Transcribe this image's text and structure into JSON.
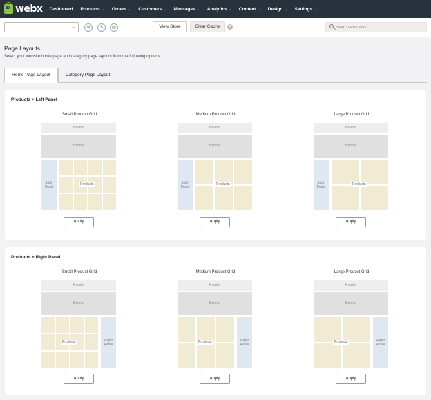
{
  "logo": {
    "mark": "BX",
    "text": "webx"
  },
  "nav": {
    "items": [
      {
        "label": "Dashboard",
        "has_menu": false
      },
      {
        "label": "Products",
        "has_menu": true
      },
      {
        "label": "Orders",
        "has_menu": true
      },
      {
        "label": "Customers",
        "has_menu": true
      },
      {
        "label": "Messages",
        "has_menu": true
      },
      {
        "label": "Analytics",
        "has_menu": true
      },
      {
        "label": "Content",
        "has_menu": true
      },
      {
        "label": "Design",
        "has_menu": true
      },
      {
        "label": "Settings",
        "has_menu": true
      }
    ]
  },
  "toolbar": {
    "store_select_value": "",
    "icons": [
      "cart-icon",
      "dollar-icon",
      "storefront-icon"
    ],
    "icon_glyphs": [
      "⊚",
      "$",
      "▤"
    ],
    "view_store_label": "View Store",
    "clear_cache_label": "Clear Cache",
    "help_glyph": "?",
    "search_placeholder": "Search Products..."
  },
  "page": {
    "title": "Page Layouts",
    "subtitle": "Select your website home page and category page layouts from the following options.",
    "tabs": [
      {
        "label": "Home Page Layout",
        "active": true
      },
      {
        "label": "Category Page Layout",
        "active": false
      }
    ]
  },
  "sections": [
    {
      "title": "Products + Left Panel",
      "panel_side": "left",
      "layouts": [
        {
          "title": "Small Product Grid",
          "header": "Header",
          "banner": "Banner",
          "panel": "Left Panel",
          "products": "Products",
          "apply": "Apply"
        },
        {
          "title": "Medium Product Grid",
          "header": "Header",
          "banner": "Banner",
          "panel": "Left Panel",
          "products": "Products",
          "apply": "Apply"
        },
        {
          "title": "Large Product Grid",
          "header": "Header",
          "banner": "Banner",
          "panel": "Left Panel",
          "products": "Products",
          "apply": "Apply"
        }
      ]
    },
    {
      "title": "Products + Right Panel",
      "panel_side": "right",
      "layouts": [
        {
          "title": "Small Product Grid",
          "header": "Header",
          "banner": "Banner",
          "panel": "Right Panel",
          "products": "Products",
          "apply": "Apply"
        },
        {
          "title": "Medium Product Grid",
          "header": "Header",
          "banner": "Banner",
          "panel": "Right Panel",
          "products": "Products",
          "apply": "Apply"
        },
        {
          "title": "Large Product Grid",
          "header": "Header",
          "banner": "Banner",
          "panel": "Right Panel",
          "products": "Products",
          "apply": "Apply"
        }
      ]
    }
  ],
  "colors": {
    "nav_bg": "#28323d",
    "brand_green": "#8cc63f",
    "panel_blue": "#dfe8f0",
    "product_cell": "#f2ebd3"
  }
}
